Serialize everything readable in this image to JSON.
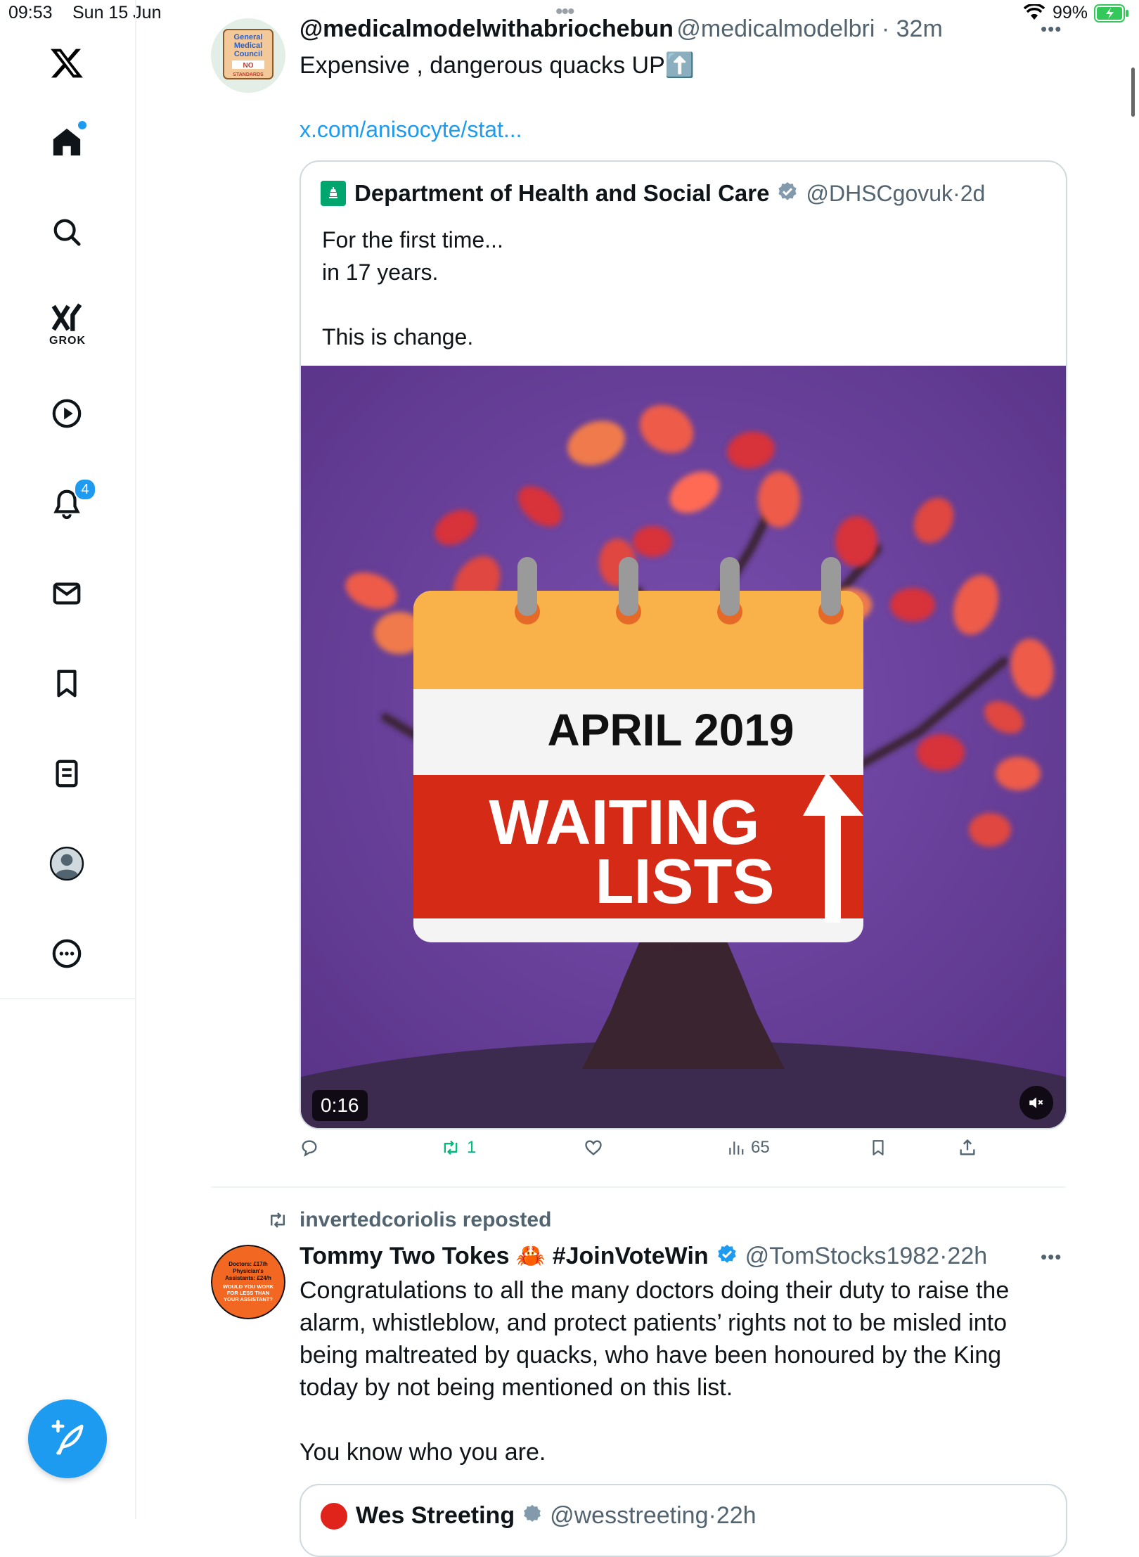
{
  "status_bar": {
    "time": "09:53",
    "date": "Sun 15 Jun",
    "battery": "99%"
  },
  "sidebar": {
    "grok_label": "GROK",
    "notifications_badge": "4",
    "items": [
      "home",
      "explore",
      "grok",
      "video",
      "notifications",
      "messages",
      "bookmarks",
      "lists",
      "profile",
      "more"
    ]
  },
  "tweet1": {
    "display_name": "@medicalmodelwithabriochebun",
    "handle": "@medicalmodelbri",
    "time": "32m",
    "text": "Expensive , dangerous quacks UP⬆️",
    "link": "x.com/anisocyte/stat...",
    "avatar_text": [
      "General",
      "Medical",
      "Council",
      "NO",
      "STANDARDS"
    ],
    "quote": {
      "display_name": "Department of Health and Social Care",
      "handle": "@DHSCgovuk",
      "time": "2d",
      "lines": [
        "For the first time...",
        "in 17 years.",
        "",
        "This is change."
      ],
      "media": {
        "calendar_month": "APRIL 2019",
        "banner_line1": "WAITING",
        "banner_line2": "LISTS",
        "duration": "0:16"
      }
    },
    "actions": {
      "reposts": "1",
      "views": "65"
    }
  },
  "tweet2": {
    "repost_by": "invertedcoriolis reposted",
    "display_name": "Tommy Two Tokes 🦀 #JoinVoteWin",
    "handle": "@TomStocks1982",
    "time": "22h",
    "paragraph1": "Congratulations to all the many doctors doing their duty to raise the alarm, whistleblow, and protect patients’ rights not to be misled into being maltreated by quacks, who have been honoured by the King today by not being mentioned on this list.",
    "paragraph2": "You know who you are.",
    "avatar_text": [
      "Doctors: £17/h",
      "Physician's",
      "Assistants: £24/h",
      "WOULD YOU WORK",
      "FOR LESS THAN",
      "YOUR ASSISTANT?"
    ],
    "quote_preview": {
      "display_name": "Wes Streeting",
      "handle": "@wesstreeting",
      "time": "22h"
    }
  },
  "colors": {
    "accent": "#1d9bf0",
    "repost_green": "#00ba7c",
    "media_bg": "#5c3a8c",
    "banner_red": "#d42a16",
    "calendar_top": "#f9a63a"
  }
}
